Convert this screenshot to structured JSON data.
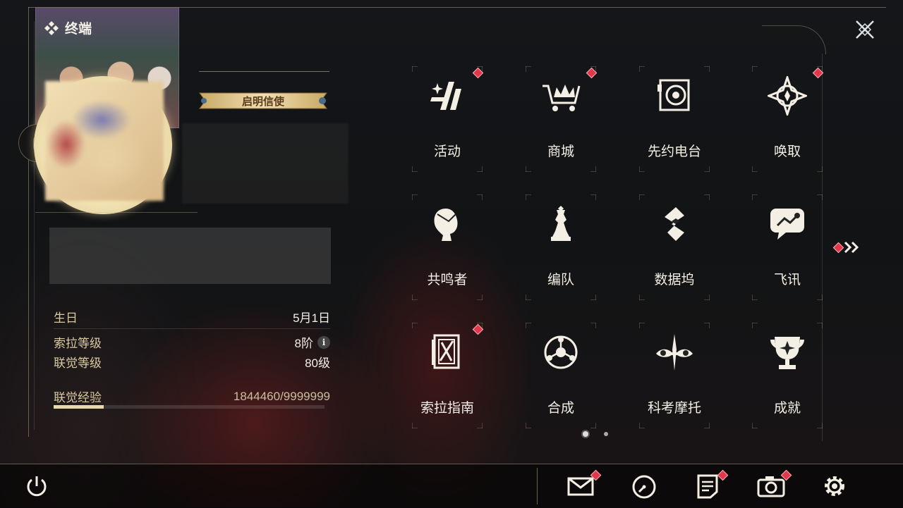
{
  "header": {
    "title": "终端"
  },
  "profile": {
    "title_badge": "启明信使",
    "stats": [
      {
        "label": "生日",
        "value": "5月1日"
      },
      {
        "label": "索拉等级",
        "value": "8阶"
      },
      {
        "label": "联觉等级",
        "value": "80级"
      }
    ],
    "exp": {
      "label": "联觉经验",
      "value": "1844460/9999999",
      "fraction": 0.184
    }
  },
  "menu": {
    "items": [
      {
        "label": "活动",
        "icon": "activity-icon",
        "badge": true
      },
      {
        "label": "商城",
        "icon": "shop-cart-icon",
        "badge": true
      },
      {
        "label": "先约电台",
        "icon": "radio-icon",
        "badge": false
      },
      {
        "label": "唤取",
        "icon": "convene-icon",
        "badge": true
      },
      {
        "label": "共鸣者",
        "icon": "resonator-icon",
        "badge": false
      },
      {
        "label": "编队",
        "icon": "team-chess-icon",
        "badge": false
      },
      {
        "label": "数据坞",
        "icon": "data-bank-icon",
        "badge": false
      },
      {
        "label": "飞讯",
        "icon": "message-icon",
        "badge": false
      },
      {
        "label": "索拉指南",
        "icon": "guidebook-icon",
        "badge": true
      },
      {
        "label": "合成",
        "icon": "synthesis-icon",
        "badge": false
      },
      {
        "label": "科考摩托",
        "icon": "motorcycle-icon",
        "badge": false
      },
      {
        "label": "成就",
        "icon": "trophy-icon",
        "badge": false
      }
    ],
    "next_page_badge": true,
    "page": {
      "current": 1,
      "total": 2
    }
  },
  "bottom_bar": {
    "buttons": [
      {
        "name": "power-icon",
        "badge": false
      },
      {
        "name": "mail-icon",
        "badge": true
      },
      {
        "name": "clock-icon",
        "badge": false
      },
      {
        "name": "notes-icon",
        "badge": true
      },
      {
        "name": "camera-icon",
        "badge": true
      },
      {
        "name": "settings-gear-icon",
        "badge": false
      }
    ]
  },
  "colors": {
    "accent": "#e8d8b0",
    "badge_red": "#e0384a",
    "text": "#f4efe4",
    "label_gold": "#d9c9a0"
  }
}
